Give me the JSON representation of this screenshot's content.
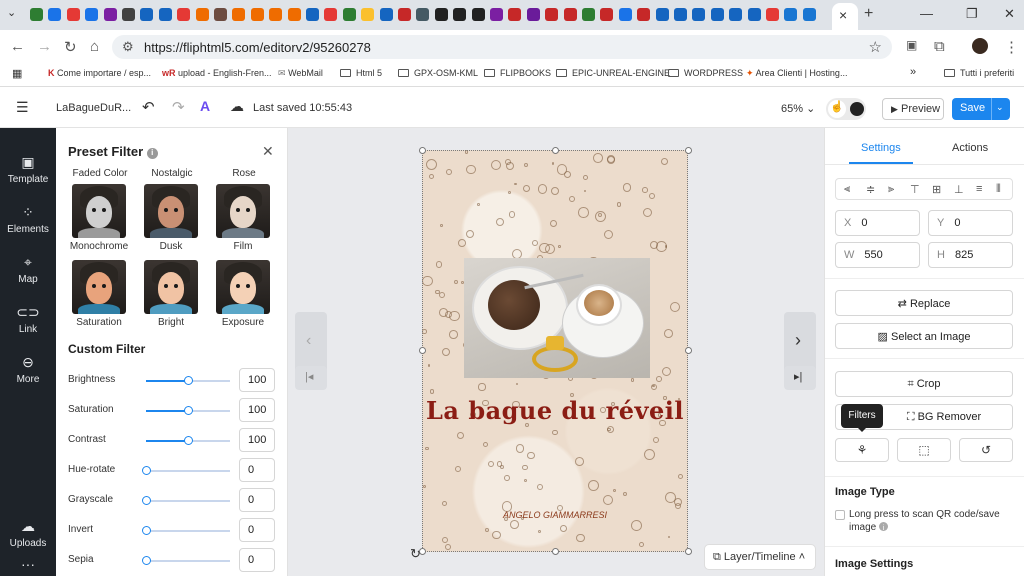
{
  "browser": {
    "tab_favicon_colors": [
      "#2e7d32",
      "#1a73e8",
      "#e53935",
      "#1a73e8",
      "#7b1fa2",
      "#424242",
      "#1565c0",
      "#1565c0",
      "#e53935",
      "#ef6c00",
      "#6d4c41",
      "#ef6c00",
      "#ef6c00",
      "#ef6c00",
      "#ef6c00",
      "#1565c0",
      "#e53935",
      "#2e7d32",
      "#fbc02d",
      "#1565c0",
      "#c62828",
      "#455a64",
      "#212121",
      "#212121",
      "#212121",
      "#7b1fa2",
      "#c62828",
      "#6a1b9a",
      "#c62828",
      "#c62828",
      "#2e7d32",
      "#c62828",
      "#1a73e8",
      "#c62828",
      "#1565c0",
      "#1565c0",
      "#1565c0",
      "#1565c0",
      "#1565c0",
      "#1565c0",
      "#e53935",
      "#1976d2",
      "#1976d2"
    ],
    "active_tab_close": "×",
    "new_tab": "+",
    "url": "https://fliphtml5.com/editorv2/95260278",
    "bookmarks": [
      {
        "label": "Come importare / esp...",
        "type": "page"
      },
      {
        "label": "upload - English-Fren...",
        "type": "page"
      },
      {
        "label": "WebMail",
        "type": "page"
      },
      {
        "label": "Html 5",
        "type": "folder"
      },
      {
        "label": "GPX-OSM-KML",
        "type": "folder"
      },
      {
        "label": "FLIPBOOKS",
        "type": "folder"
      },
      {
        "label": "EPIC-UNREAL-ENGINE",
        "type": "folder"
      },
      {
        "label": "WORDPRESS",
        "type": "folder"
      },
      {
        "label": "Area Clienti | Hosting...",
        "type": "page"
      },
      {
        "label": "Tutti i preferiti",
        "type": "folder"
      }
    ]
  },
  "header": {
    "doc_name": "LaBagueDuR...",
    "saved": "Last saved 10:55:43",
    "zoom": "65%",
    "preview": "Preview",
    "save": "Save"
  },
  "rail": [
    {
      "label": "Template",
      "icon": "template-icon"
    },
    {
      "label": "Elements",
      "icon": "elements-icon"
    },
    {
      "label": "Map",
      "icon": "map-pin-icon"
    },
    {
      "label": "Link",
      "icon": "link-icon"
    },
    {
      "label": "More",
      "icon": "more-icon"
    },
    {
      "label": "Uploads",
      "icon": "upload-cloud-icon"
    }
  ],
  "filter_panel": {
    "title": "Preset Filter",
    "cut_row": [
      "Faded Color",
      "Nostalgic",
      "Rose"
    ],
    "presets": [
      {
        "label": "Monochrome",
        "skin": "#cfcfcf",
        "shirt": "#9a9a9a"
      },
      {
        "label": "Dusk",
        "skin": "#c99074",
        "shirt": "#4a5b6a"
      },
      {
        "label": "Film",
        "skin": "#e6d6c8",
        "shirt": "#6c7a86"
      },
      {
        "label": "Saturation",
        "skin": "#e8a37c",
        "shirt": "#2f7fa6"
      },
      {
        "label": "Bright",
        "skin": "#f1c3a4",
        "shirt": "#4f9cc0"
      },
      {
        "label": "Exposure",
        "skin": "#f4d1b6",
        "shirt": "#5aa7c8"
      }
    ],
    "custom_title": "Custom Filter",
    "sliders": [
      {
        "label": "Brightness",
        "value": "100",
        "fraction": 0.5
      },
      {
        "label": "Saturation",
        "value": "100",
        "fraction": 0.5
      },
      {
        "label": "Contrast",
        "value": "100",
        "fraction": 0.5
      },
      {
        "label": "Hue-rotate",
        "value": "0",
        "fraction": 0
      },
      {
        "label": "Grayscale",
        "value": "0",
        "fraction": 0
      },
      {
        "label": "Invert",
        "value": "0",
        "fraction": 0
      },
      {
        "label": "Sepia",
        "value": "0",
        "fraction": 0
      }
    ]
  },
  "page": {
    "title": "La bague du réveil",
    "author": "ANGELO GIAMMARRESI"
  },
  "canvas": {
    "layer_button": "Layer/Timeline"
  },
  "settings": {
    "tabs": [
      "Settings",
      "Actions"
    ],
    "x_label": "X",
    "x": "0",
    "y_label": "Y",
    "y": "0",
    "w_label": "W",
    "w": "550",
    "h_label": "H",
    "h": "825",
    "replace": "Replace",
    "select_image": "Select an Image",
    "crop": "Crop",
    "tooltip": "Filters",
    "bg_remover": "BG Remover",
    "image_type": "Image Type",
    "qr_option": "Long press to scan QR code/save image",
    "image_settings": "Image Settings"
  },
  "colors": {
    "accent": "#1c86ee",
    "rail_bg": "#1e2329",
    "title_red": "#8b1d14"
  }
}
